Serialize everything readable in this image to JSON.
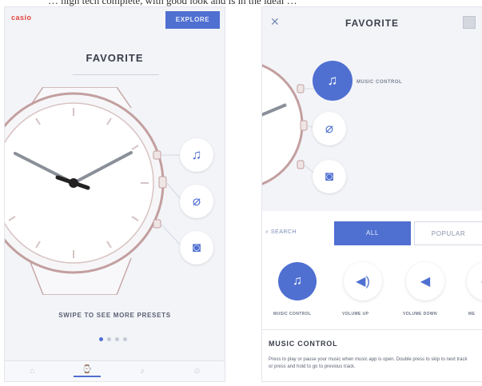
{
  "caption": "… high tech complete, with good look and is in the ideal …",
  "phone1": {
    "brand": "casio",
    "explore_label": "EXPLORE",
    "title": "FAVORITE",
    "swipe_hint": "SWIPE TO SEE MORE PRESETS",
    "favorites": [
      {
        "name": "music",
        "icon": "music-note-icon"
      },
      {
        "name": "link",
        "icon": "paperclip-icon"
      },
      {
        "name": "camera",
        "icon": "camera-icon"
      }
    ],
    "page_dots": {
      "count": 4,
      "active": 1
    },
    "bottom_nav": [
      {
        "icon": "home-icon"
      },
      {
        "icon": "watch-icon",
        "active": true
      },
      {
        "icon": "bell-icon"
      },
      {
        "icon": "profile-icon"
      }
    ]
  },
  "phone2": {
    "title": "FAVORITE",
    "selected_label": "MUSIC CONTROL",
    "search_label": "SEARCH",
    "tabs": [
      "ALL",
      "POPULAR"
    ],
    "actions": [
      {
        "label": "MUSIC CONTROL",
        "icon": "music-note-icon",
        "selected": true
      },
      {
        "label": "VOLUME UP",
        "icon": "volume-up-icon"
      },
      {
        "label": "VOLUME DOWN",
        "icon": "volume-down-icon"
      },
      {
        "label": "ME",
        "icon": "partial-icon"
      }
    ],
    "section_title": "MUSIC CONTROL",
    "description": "Press to play or pause your music when music app is open. Double press to skip to next track or press and hold to go to previous track."
  },
  "colors": {
    "accent": "#4f6fd1",
    "brand": "#e2473d"
  }
}
